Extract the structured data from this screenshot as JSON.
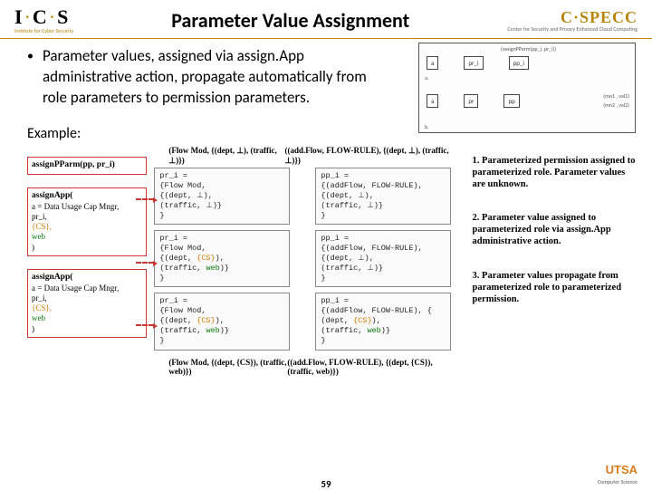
{
  "header": {
    "logo_left_text": "I·C·S",
    "logo_left_sub": "Institute for Cyber Security",
    "title": "Parameter Value Assignment",
    "logo_right_text": "C·SPECC",
    "logo_right_sub": "Center for Security and Privacy Enhanced Cloud Computing"
  },
  "bullet": "Parameter values, assigned via assign.App administrative action, propagate automatically from role parameters to permission parameters.",
  "top_diagram": {
    "a_left": "a",
    "a_pr": "pr_i",
    "a_pp": "pp_i",
    "a_top": "(assignPParm(pp_i, pr_i))",
    "b_left": "a",
    "b_pr": "pr",
    "b_pp": "pp",
    "b_r1": "(mn1 , val1)",
    "b_r2": "(mn2 , val2)",
    "b_label": "b."
  },
  "example_label": "Example:",
  "head_left": "(Flow Mod, {(dept, ⊥), (traffic, ⊥)})",
  "head_right": "((add.Flow, FLOW-RULE), {(dept, ⊥), (traffic, ⊥)})",
  "left_blocks": [
    {
      "hd": "assignPParm(pp, pr_i)"
    },
    {
      "hd": "assignApp(",
      "lines": [
        "a = Data Usage Cap Mngr,",
        "pr_i,",
        "{CS},",
        "web",
        ")"
      ]
    },
    {
      "hd": "assignApp(",
      "lines": [
        "a = Data Usage Cap Mngr,",
        "pr_i,",
        "{CS},",
        "web",
        ")"
      ]
    }
  ],
  "pairs": [
    {
      "left": [
        "pr_i =",
        "{Flow Mod,",
        "{(dept, ⊥),",
        "(traffic, ⊥)}",
        "}"
      ],
      "right": [
        "pp_i =",
        "{(addFlow, FLOW-RULE),",
        "{(dept, ⊥),",
        "(traffic, ⊥)}",
        "}"
      ]
    },
    {
      "left": [
        "pr_i =",
        "{Flow Mod,",
        "{(dept, {CS}),",
        "(traffic, web)}",
        "}"
      ],
      "right": [
        "pp_i =",
        "{(addFlow, FLOW-RULE),",
        "{(dept, ⊥),",
        "(traffic, ⊥)}",
        "}"
      ]
    },
    {
      "left": [
        "pr_i =",
        "{Flow Mod,",
        "{(dept, {CS}),",
        "(traffic, web)}",
        "}"
      ],
      "right": [
        "pp_i =",
        "{(addFlow, FLOW-RULE), {",
        "(dept, {CS}),",
        "(traffic, web)}",
        "}"
      ]
    }
  ],
  "bottom_left": "(Flow Mod, {(dept, {CS}), (traffic, web)})",
  "bottom_right": "((add.Flow, FLOW-RULE), {(dept, {CS}), (traffic, web)})",
  "notes": [
    "1. Parameterized permission assigned to parameterized role. Parameter values are unknown.",
    "2. Parameter value assigned to parameterized role via assign.App administrative action.",
    "3. Parameter values propagate from parameterized role to parameterized permission."
  ],
  "footer": {
    "page": "59",
    "utsa": "UTSA",
    "utsa_sub": "Computer Science"
  }
}
